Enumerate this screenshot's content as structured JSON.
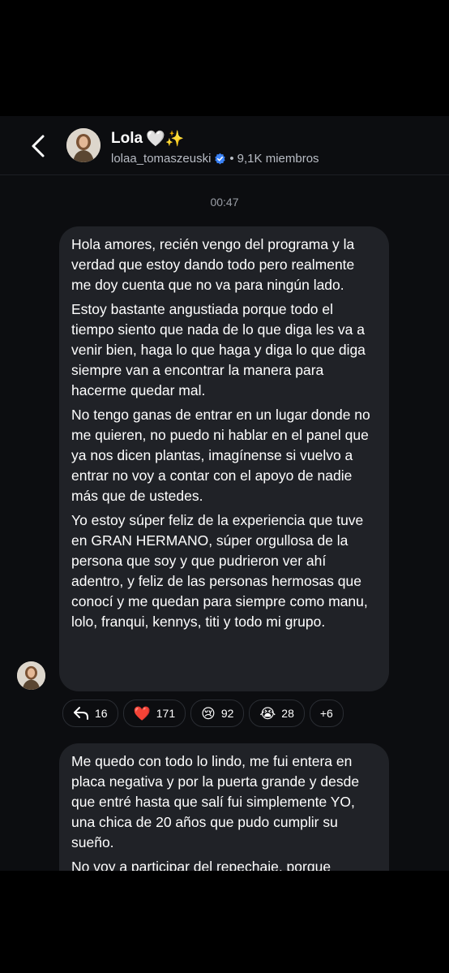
{
  "header": {
    "back_icon": "chevron-left-icon",
    "title": "Lola",
    "title_emojis": "🤍✨",
    "username": "lolaa_tomaszeuski",
    "verified_color": "#3b82f6",
    "separator": "•",
    "members": "9,1K miembros"
  },
  "timestamp": "00:47",
  "message1": {
    "paragraphs": [
      "Hola amores, recién vengo del programa y la verdad que estoy dando todo pero realmente me doy cuenta que no va para ningún lado.",
      "Estoy bastante angustiada porque todo el tiempo siento que nada de lo que diga les va a venir bien, haga lo que haga y diga lo que diga siempre van a encontrar la manera para hacerme quedar mal.",
      "No tengo ganas de entrar en un lugar donde no me quieren, no puedo ni hablar en el panel que ya nos dicen plantas, imagínense si vuelvo a entrar no voy a contar con el apoyo de nadie más que de ustedes.",
      "Yo estoy súper feliz de la experiencia que tuve en GRAN HERMANO, súper orgullosa de la persona que soy y que pudrieron ver ahí adentro, y feliz de las personas hermosas que conocí y me quedan para siempre como manu, lolo, franqui, kennys, titi y todo mi grupo."
    ]
  },
  "reactions": [
    {
      "emoji": "↩",
      "count": "16",
      "icon": "reply-icon"
    },
    {
      "emoji": "❤️",
      "count": "171",
      "icon": "heart-icon"
    },
    {
      "emoji": "😢",
      "count": "92",
      "icon": "sad-face-icon"
    },
    {
      "emoji": "😭",
      "count": "28",
      "icon": "crying-face-icon"
    },
    {
      "emoji": "",
      "count": "+6",
      "icon": "more-reactions"
    }
  ],
  "message2": {
    "paragraphs": [
      "Me quedo con todo lo lindo, me fui entera en placa negativa y por la puerta grande y desde que entré hasta que salí fui simplemente YO, una chica de 20 años que pudo cumplir su sueño.",
      "No voy a participar del repechaje, porque"
    ]
  }
}
